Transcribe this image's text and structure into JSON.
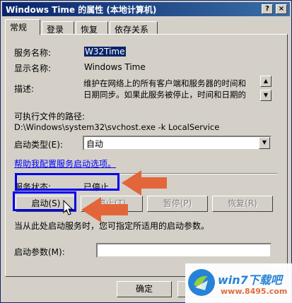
{
  "window": {
    "title": "Windows Time 的属性 (本地计算机)"
  },
  "titlebar_buttons": {
    "help": "?",
    "close": "×"
  },
  "tabs": [
    {
      "label": "常规",
      "active": true
    },
    {
      "label": "登录",
      "active": false
    },
    {
      "label": "恢复",
      "active": false
    },
    {
      "label": "依存关系",
      "active": false
    }
  ],
  "general": {
    "service_name_label": "服务名称:",
    "service_name_value": "W32Time",
    "display_name_label": "显示名称:",
    "display_name_value": "Windows Time",
    "description_label": "描述:",
    "description_line1": "维护在网络上的所有客户端和服务器的时间和",
    "description_line2": "日期同步。如果此服务被停止，时间和日期的",
    "exe_path_label": "可执行文件的路径:",
    "exe_path_value": "D:\\Windows\\system32\\svchost.exe -k LocalService",
    "startup_type_label": "启动类型(E):",
    "startup_type_value": "自动",
    "help_link": "帮助我配置服务启动选项。",
    "status_label": "服务状态:",
    "status_value": "已停止",
    "start_button": "启动(S)",
    "stop_button": "停止(T)",
    "pause_button": "暂停(P)",
    "resume_button": "恢复(R)",
    "start_hint": "当从此处启动服务时，您可指定所适用的启动参数。",
    "start_params_label": "启动参数(M):",
    "start_params_value": ""
  },
  "footer": {
    "ok_button": "确定"
  },
  "watermark": {
    "brand": "win7下载吧",
    "url": "www.8495.com"
  },
  "colors": {
    "highlight_box": "#0000ee",
    "arrow": "#e2663a",
    "link": "#0000ff"
  }
}
